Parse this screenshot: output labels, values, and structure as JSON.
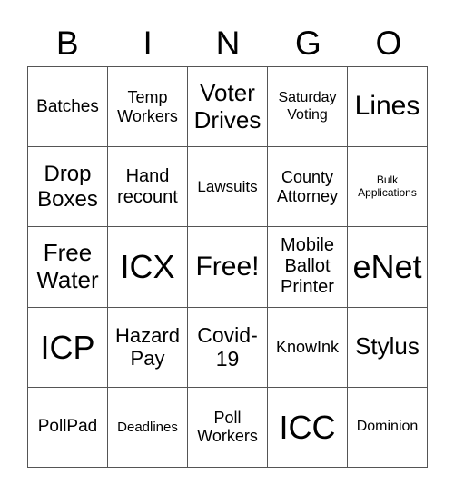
{
  "header": {
    "letters": [
      "B",
      "I",
      "N",
      "G",
      "O"
    ]
  },
  "cells": [
    "Batches",
    "Temp Workers",
    "Voter Drives",
    "Saturday Voting",
    "Lines",
    "Drop Boxes",
    "Hand recount",
    "Lawsuits",
    "County Attorney",
    "Bulk Applications",
    "Free Water",
    "ICX",
    "Free!",
    "Mobile Ballot Printer",
    "eNet",
    "ICP",
    "Hazard Pay",
    "Covid-19",
    "KnowInk",
    "Stylus",
    "PollPad",
    "Deadlines",
    "Poll Workers",
    "ICC",
    "Dominion"
  ]
}
